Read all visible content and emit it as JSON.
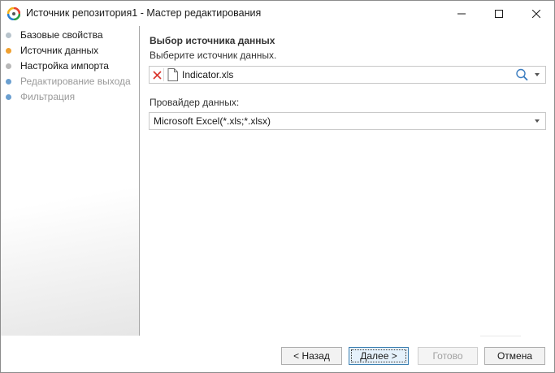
{
  "window": {
    "title": "Источник репозитория1 - Мастер редактирования"
  },
  "steps": [
    {
      "label": "Базовые свойства",
      "state": "done",
      "dot_color": "#b8c4cc"
    },
    {
      "label": "Источник данных",
      "state": "current",
      "dot_color": "#f0a030"
    },
    {
      "label": "Настройка импорта",
      "state": "pending",
      "dot_color": "#b8b8b8"
    },
    {
      "label": "Редактирование выхода",
      "state": "disabled",
      "dot_color": "#6a9fd0"
    },
    {
      "label": "Фильтрация",
      "state": "disabled",
      "dot_color": "#6a9fd0"
    }
  ],
  "main": {
    "section_title": "Выбор источника данных",
    "section_hint": "Выберите источник данных.",
    "source": {
      "value": "Indicator.xls",
      "clear_icon": "clear-icon",
      "file_icon": "file-icon",
      "search_icon": "search-icon"
    },
    "provider": {
      "label": "Провайдер данных:",
      "value": "Microsoft Excel(*.xls;*.xlsx)"
    }
  },
  "footer": {
    "back": "< Назад",
    "next": "Далее >",
    "finish": "Готово",
    "cancel": "Отмена"
  },
  "colors": {
    "accent_focus": "#3c7fb1",
    "clear_red": "#d9342b",
    "current_step": "#f0a030"
  }
}
